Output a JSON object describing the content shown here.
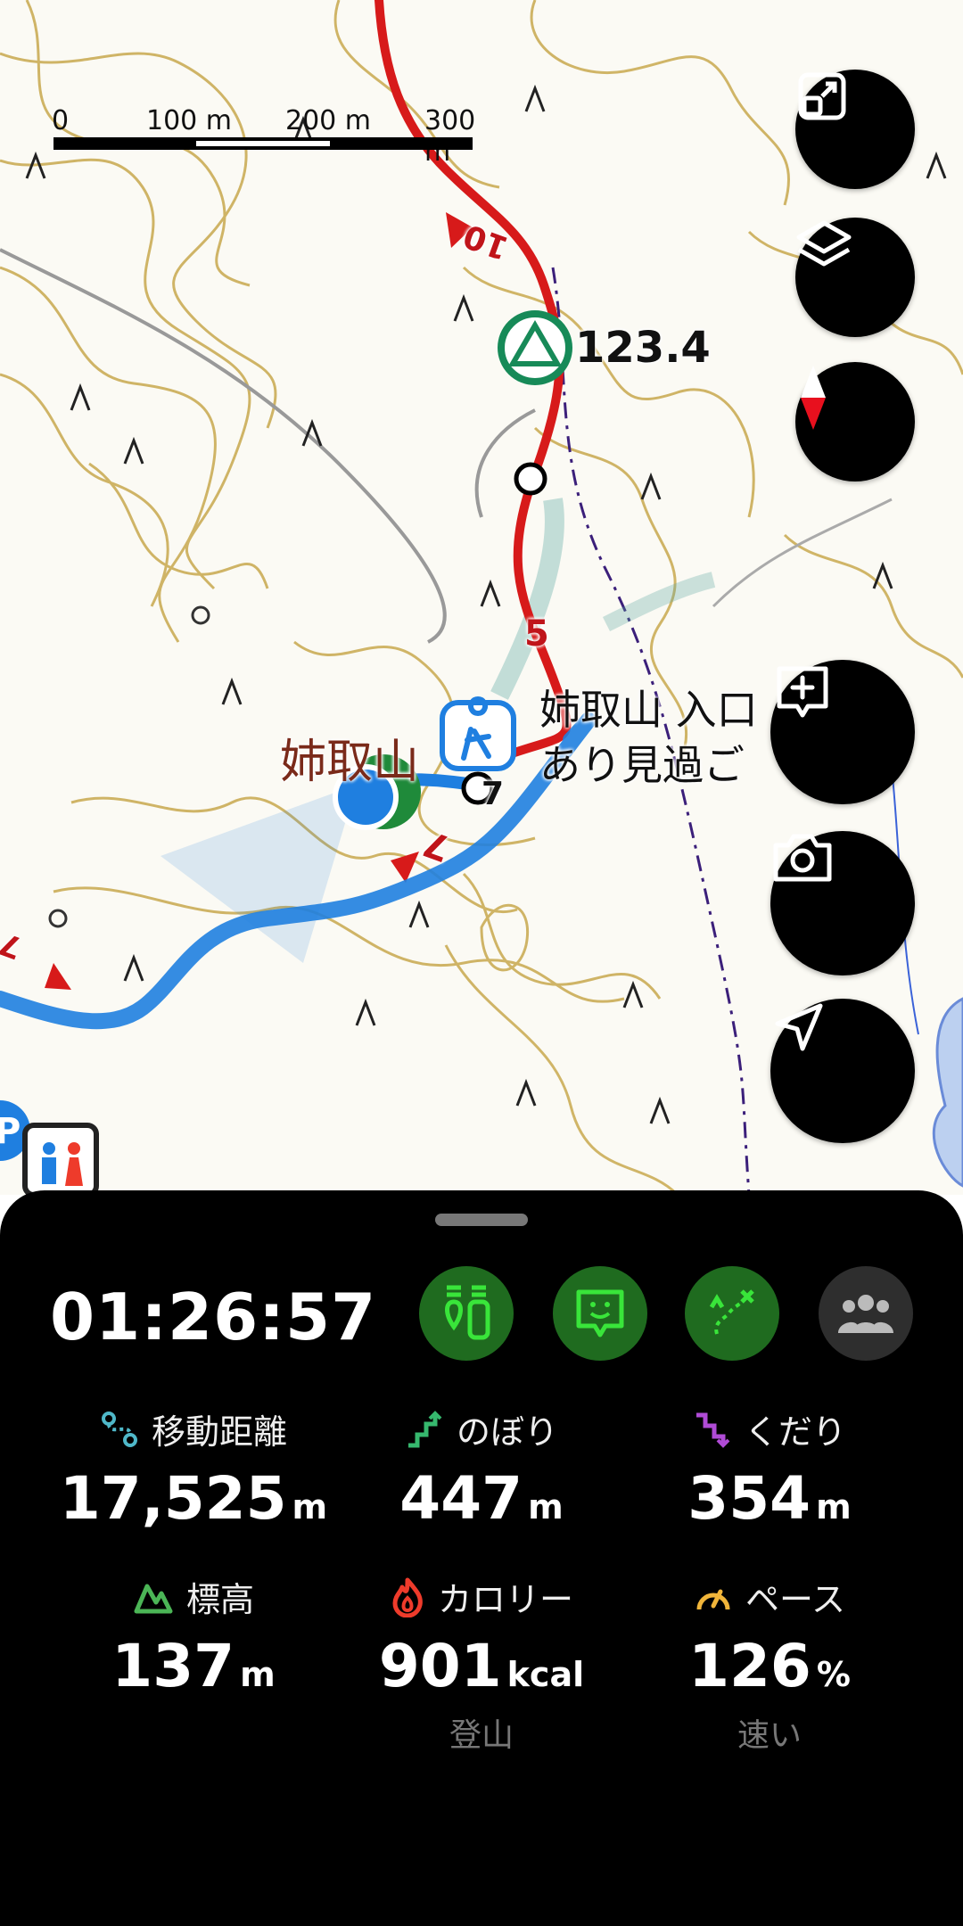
{
  "map": {
    "scale": {
      "labels": [
        "0",
        "100 m",
        "200 m",
        "300 m"
      ]
    },
    "peak_elevation": "123.4",
    "trail_markers": [
      "10",
      "5",
      "7",
      "7"
    ],
    "place_label": "姉取山",
    "note_line1": "姉取山 入口",
    "note_line2": "あり見過ご",
    "side_marker": "7",
    "controls": {
      "fit-icon": "expand-arrows",
      "layers-icon": "layers",
      "compass-icon": "compass",
      "add-memo-icon": "plus-bubble",
      "camera-icon": "camera",
      "location-icon": "navigation-arrow"
    }
  },
  "panel": {
    "timer": "01:26:57",
    "stats": [
      {
        "label": "移動距離",
        "value": "17,525",
        "unit": "m",
        "sub": "",
        "icon": "route-icon",
        "color": "#4fb8c9"
      },
      {
        "label": "のぼり",
        "value": "447",
        "unit": "m",
        "sub": "",
        "icon": "ascent-icon",
        "color": "#36b86e"
      },
      {
        "label": "くだり",
        "value": "354",
        "unit": "m",
        "sub": "",
        "icon": "descent-icon",
        "color": "#b04bd6"
      },
      {
        "label": "標高",
        "value": "137",
        "unit": "m",
        "sub": "",
        "icon": "elevation-icon",
        "color": "#4bb556"
      },
      {
        "label": "カロリー",
        "value": "901",
        "unit": "kcal",
        "sub": "登山",
        "icon": "flame-icon",
        "color": "#ee3b2b"
      },
      {
        "label": "ペース",
        "value": "126",
        "unit": "%",
        "sub": "速い",
        "icon": "speedometer-icon",
        "color": "#f1b53a"
      }
    ],
    "accent_green": "#2e8b2e",
    "icon_green": "#39e53a"
  }
}
